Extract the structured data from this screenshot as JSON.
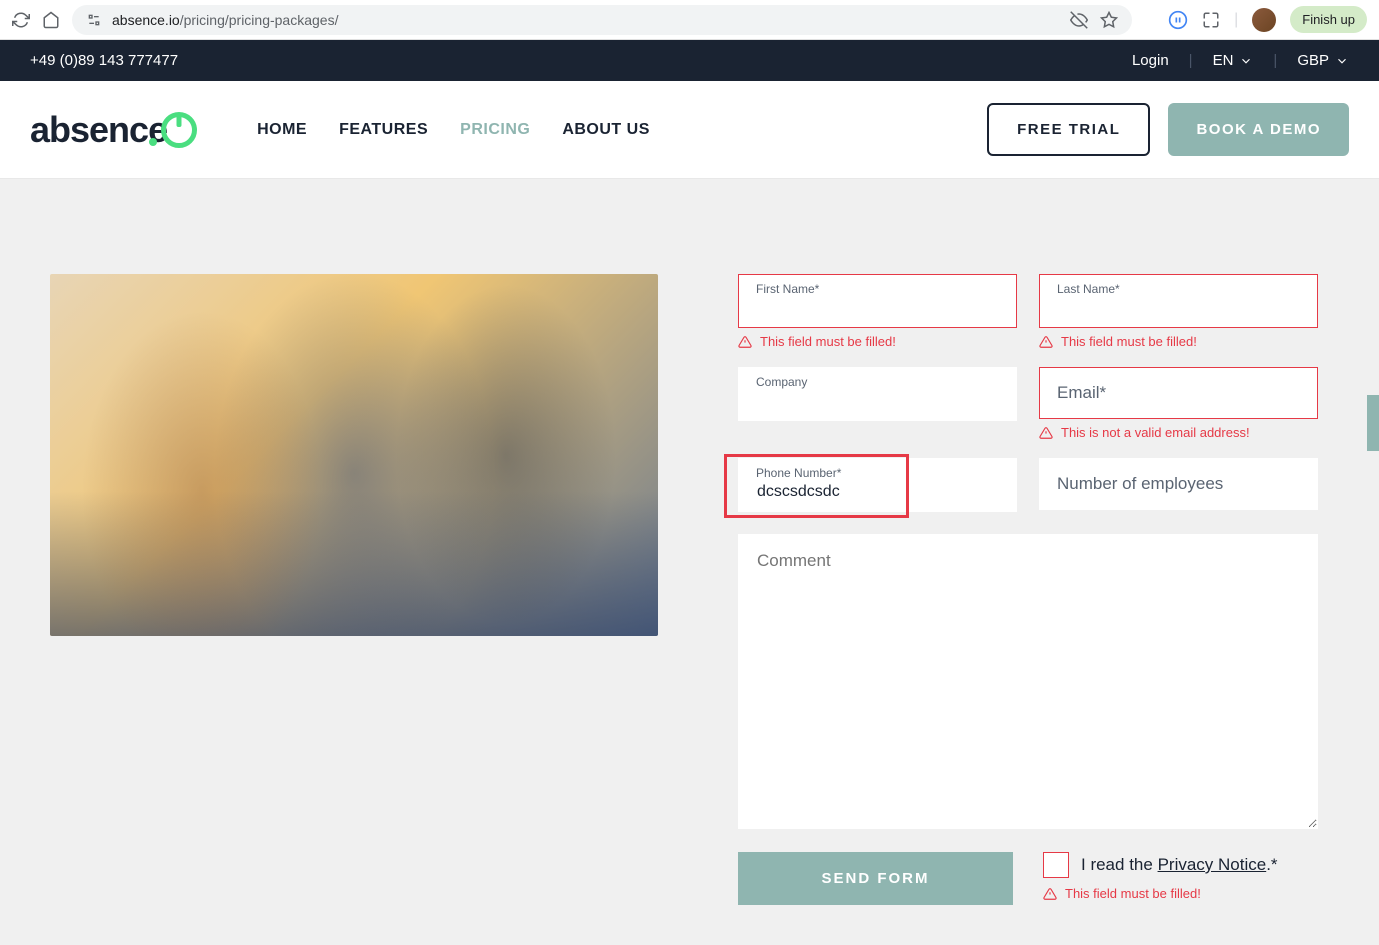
{
  "browser": {
    "url_domain": "absence.io",
    "url_path": "/pricing/pricing-packages/",
    "finish_label": "Finish up"
  },
  "topbar": {
    "phone": "+49 (0)89 143 777477",
    "login": "Login",
    "language": "EN",
    "currency": "GBP"
  },
  "nav": {
    "logo_text": "absence",
    "home": "HOME",
    "features": "FEATURES",
    "pricing": "PRICING",
    "about": "ABOUT US",
    "free_trial": "FREE TRIAL",
    "book_demo": "BOOK A DEMO"
  },
  "form": {
    "first_name_label": "First Name*",
    "last_name_label": "Last Name*",
    "company_label": "Company",
    "email_label": "Email*",
    "phone_label": "Phone Number*",
    "phone_value": "dcscsdcsdc",
    "employees_label": "Number of employees",
    "comment_label": "Comment",
    "send_label": "SEND FORM",
    "privacy_prefix": "I read the ",
    "privacy_link": "Privacy Notice",
    "privacy_suffix": ".*",
    "error_required": "This field must be filled!",
    "error_email": "This is not a valid email address!"
  }
}
